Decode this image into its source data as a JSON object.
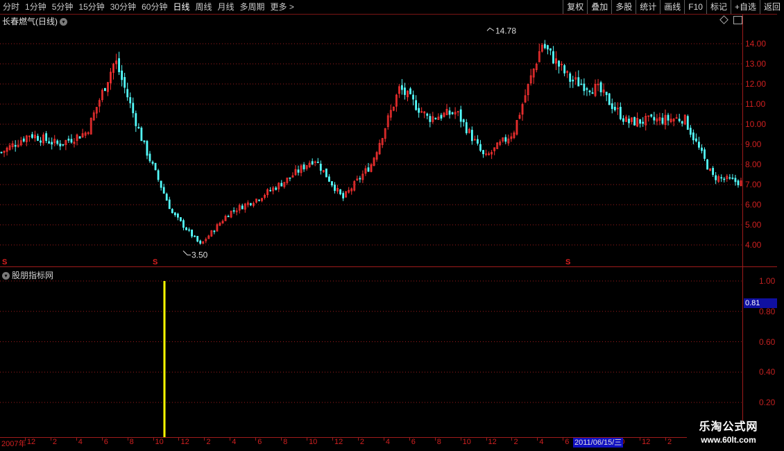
{
  "toolbar": {
    "periods": [
      "分时",
      "1分钟",
      "5分钟",
      "15分钟",
      "30分钟",
      "60分钟",
      "日线",
      "周线",
      "月线",
      "多周期",
      "更多 >"
    ],
    "active_period": "日线",
    "buttons": [
      "复权",
      "叠加",
      "多股",
      "统计",
      "画线",
      "F10",
      "标记",
      "+自选",
      "返回"
    ]
  },
  "main_chart": {
    "title": "长春燃气(日线)",
    "y_ticks": [
      "14.00",
      "13.00",
      "12.00",
      "11.00",
      "10.00",
      "9.00",
      "8.00",
      "7.00",
      "6.00",
      "5.00",
      "4.00"
    ],
    "high_label": "14.78",
    "low_label": "3.50",
    "s_mark": "S"
  },
  "indicator": {
    "title": "股朋指标网",
    "y_ticks": [
      "1.00",
      "0.80",
      "0.60",
      "0.40",
      "0.20"
    ],
    "current_value": "0.81"
  },
  "x_axis": {
    "labels": [
      "2007年",
      "12",
      "2",
      "4",
      "6",
      "8",
      "10",
      "12",
      "2",
      "4",
      "6",
      "8",
      "10",
      "12",
      "2",
      "4",
      "6",
      "8",
      "10",
      "12",
      "2",
      "4",
      "6",
      "8",
      "10",
      "12",
      "2"
    ],
    "date_cursor": "2011/06/15/三"
  },
  "watermark": {
    "line1": "乐淘公式网",
    "line2": "www.60lt.com"
  },
  "colors": {
    "up": "#ff3232",
    "down": "#54fcfc",
    "signal": "#ffff00",
    "grid": "#a01c1c"
  },
  "chart_data": {
    "type": "candlestick",
    "title": "长春燃气(日线)",
    "x": [
      "2007-10",
      "2007-12",
      "2008-02",
      "2008-04",
      "2008-06",
      "2008-08",
      "2008-10",
      "2008-12",
      "2009-02",
      "2009-04",
      "2009-06",
      "2009-08",
      "2009-10",
      "2009-12",
      "2010-02",
      "2010-04",
      "2010-06",
      "2010-08",
      "2010-10",
      "2010-12",
      "2011-02",
      "2011-04",
      "2011-06",
      "2011-08",
      "2011-10",
      "2011-12",
      "2012-02"
    ],
    "close": [
      8.6,
      9.5,
      9.0,
      9.6,
      13.2,
      9.0,
      5.6,
      4.0,
      5.6,
      6.3,
      7.2,
      8.3,
      6.3,
      8.0,
      11.8,
      10.3,
      10.6,
      8.3,
      9.6,
      14.0,
      12.2,
      11.7,
      10.1,
      10.2,
      10.3,
      7.4,
      7.1
    ],
    "high_marker": 14.78,
    "low_marker": 3.5,
    "ylim": [
      3.5,
      15.0
    ],
    "indicator": {
      "name": "股朋指标网",
      "current_value": 0.81,
      "signal_at": "2008-09",
      "signal_value": 1.0,
      "ylim": [
        0,
        1.05
      ]
    }
  }
}
